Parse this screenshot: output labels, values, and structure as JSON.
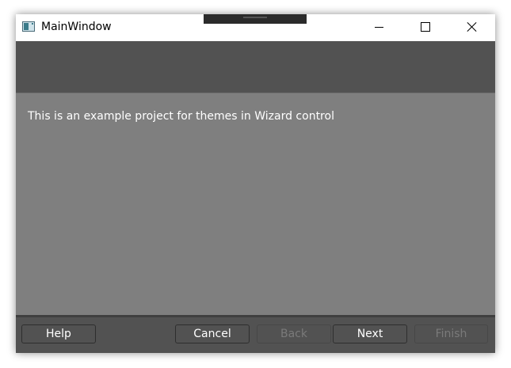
{
  "window": {
    "title": "MainWindow"
  },
  "wizard": {
    "page_text": "This is an example project for themes in Wizard control"
  },
  "buttons": {
    "help": "Help",
    "cancel": "Cancel",
    "back": "Back",
    "next": "Next",
    "finish": "Finish"
  },
  "colors": {
    "header_band": "#525252",
    "content_bg": "#7f7f7f",
    "footer_bg": "#525252",
    "text": "#ffffff",
    "disabled_text": "#7a7a7a"
  },
  "icons": {
    "app": "app-window-icon",
    "minimize": "minimize-icon",
    "maximize": "maximize-icon",
    "close": "close-icon"
  }
}
